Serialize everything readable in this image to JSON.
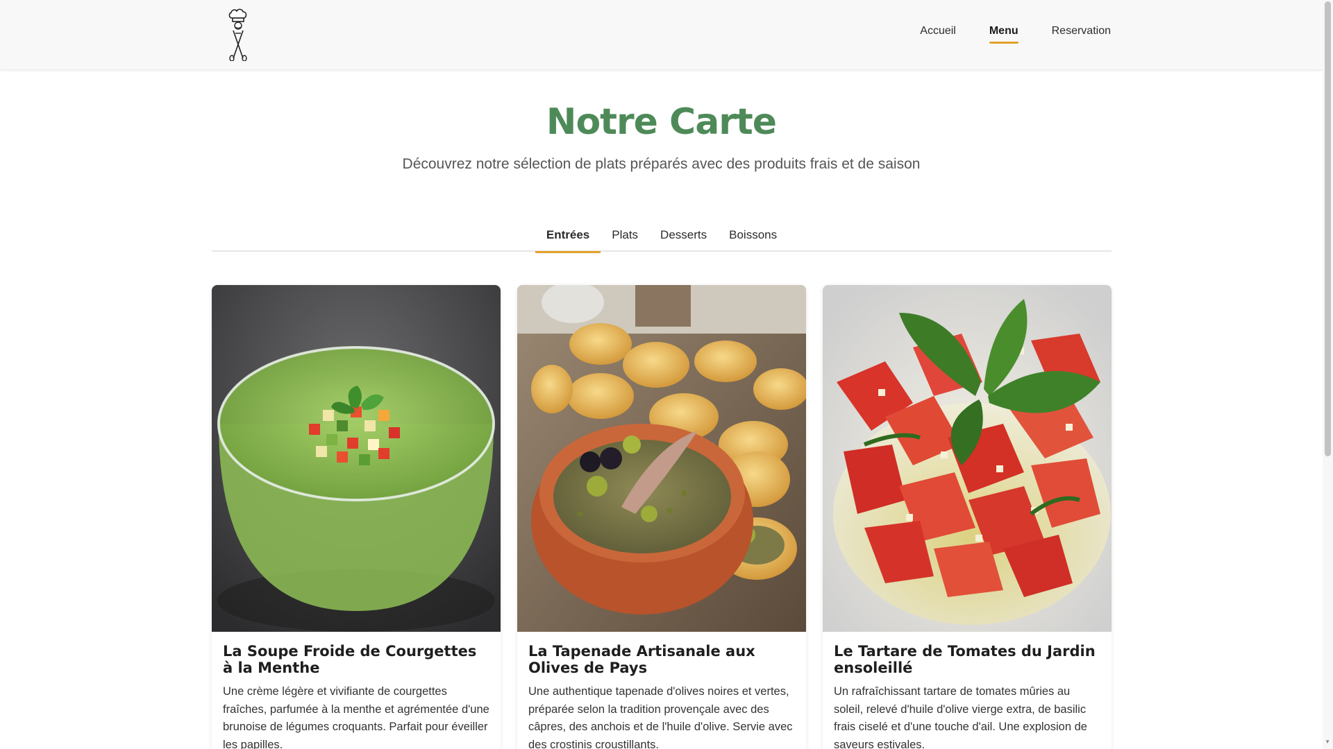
{
  "header": {
    "logo_icon": "chef-hat-utensils-icon",
    "nav": [
      {
        "label": "Accueil",
        "active": false
      },
      {
        "label": "Menu",
        "active": true
      },
      {
        "label": "Reservation",
        "active": false
      }
    ]
  },
  "hero": {
    "title": "Notre Carte",
    "subtitle": "Découvrez notre sélection de plats préparés avec des produits frais et de saison"
  },
  "tabs": [
    {
      "label": "Entrées",
      "active": true
    },
    {
      "label": "Plats",
      "active": false
    },
    {
      "label": "Desserts",
      "active": false
    },
    {
      "label": "Boissons",
      "active": false
    }
  ],
  "cards": [
    {
      "title": "La Soupe Froide de Courgettes à la Menthe",
      "description": "Une crème légère et vivifiante de courgettes fraîches, parfumée à la menthe et agrémentée d'une brunoise de légumes croquants. Parfait pour éveiller les papilles.",
      "image": "zucchini-soup-photo"
    },
    {
      "title": "La Tapenade Artisanale aux Olives de Pays",
      "description": "Une authentique tapenade d'olives noires et vertes, préparée selon la tradition provençale avec des câpres, des anchois et de l'huile d'olive. Servie avec des crostinis croustillants.",
      "image": "tapenade-photo"
    },
    {
      "title": "Le Tartare de Tomates du Jardin ensoleillé",
      "description": "Un rafraîchissant tartare de tomates mûries au soleil, relevé d'huile d'olive vierge extra, de basilic frais ciselé et d'une touche d'ail. Une explosion de saveurs estivales.",
      "image": "tomato-tartare-photo"
    }
  ],
  "colors": {
    "accent": "#e3a12a",
    "title_green": "#4e8a58",
    "header_bg": "#f8f8f8"
  }
}
